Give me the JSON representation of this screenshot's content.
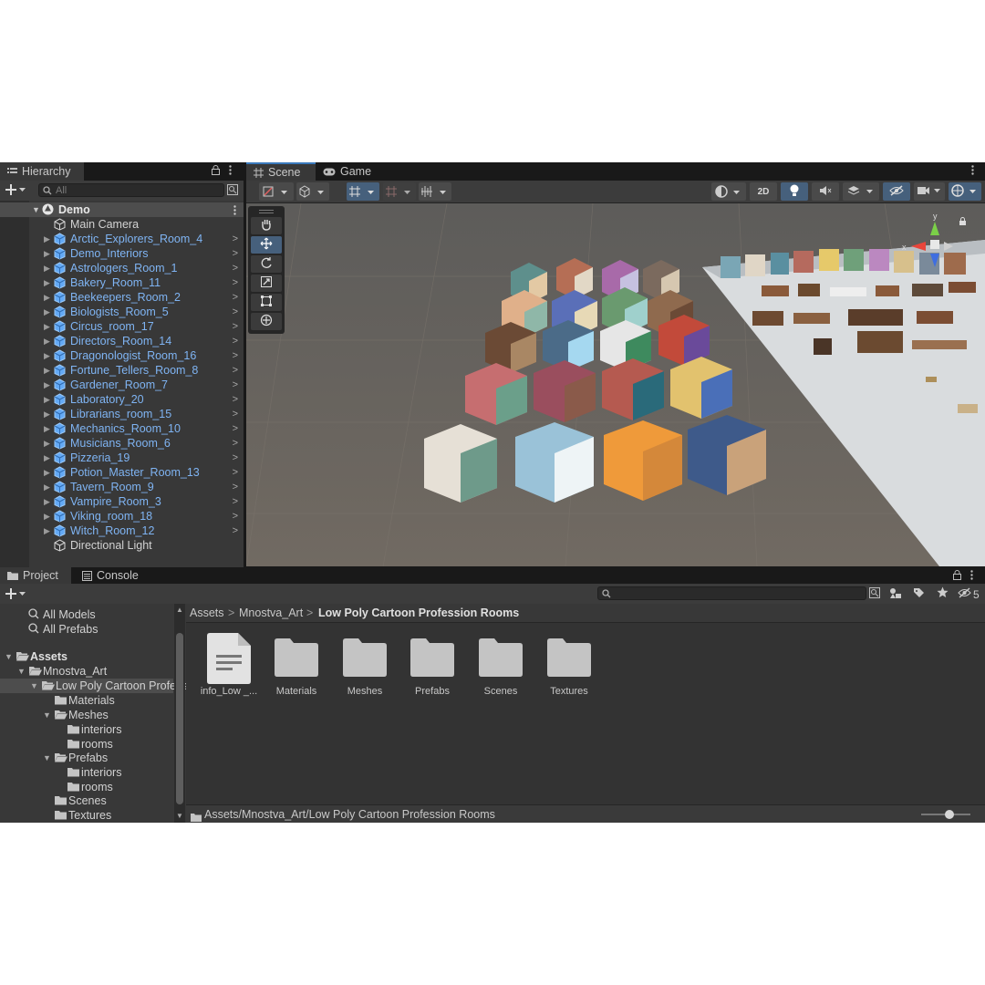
{
  "hierarchy": {
    "tab_label": "Hierarchy",
    "search_placeholder": "All",
    "scene_name": "Demo",
    "items": [
      {
        "label": "Main Camera",
        "prefab": false,
        "expandable": false
      },
      {
        "label": "Arctic_Explorers_Room_4",
        "prefab": true,
        "expandable": true
      },
      {
        "label": "Demo_Interiors",
        "prefab": true,
        "expandable": true
      },
      {
        "label": "Astrologers_Room_1",
        "prefab": true,
        "expandable": true
      },
      {
        "label": "Bakery_Room_11",
        "prefab": true,
        "expandable": true
      },
      {
        "label": "Beekeepers_Room_2",
        "prefab": true,
        "expandable": true
      },
      {
        "label": "Biologists_Room_5",
        "prefab": true,
        "expandable": true
      },
      {
        "label": "Circus_room_17",
        "prefab": true,
        "expandable": true
      },
      {
        "label": "Directors_Room_14",
        "prefab": true,
        "expandable": true
      },
      {
        "label": "Dragonologist_Room_16",
        "prefab": true,
        "expandable": true
      },
      {
        "label": "Fortune_Tellers_Room_8",
        "prefab": true,
        "expandable": true
      },
      {
        "label": "Gardener_Room_7",
        "prefab": true,
        "expandable": true
      },
      {
        "label": "Laboratory_20",
        "prefab": true,
        "expandable": true
      },
      {
        "label": "Librarians_room_15",
        "prefab": true,
        "expandable": true
      },
      {
        "label": "Mechanics_Room_10",
        "prefab": true,
        "expandable": true
      },
      {
        "label": "Musicians_Room_6",
        "prefab": true,
        "expandable": true
      },
      {
        "label": "Pizzeria_19",
        "prefab": true,
        "expandable": true
      },
      {
        "label": "Potion_Master_Room_13",
        "prefab": true,
        "expandable": true
      },
      {
        "label": "Tavern_Room_9",
        "prefab": true,
        "expandable": true
      },
      {
        "label": "Vampire_Room_3",
        "prefab": true,
        "expandable": true
      },
      {
        "label": "Viking_room_18",
        "prefab": true,
        "expandable": true
      },
      {
        "label": "Witch_Room_12",
        "prefab": true,
        "expandable": true
      },
      {
        "label": "Directional Light",
        "prefab": false,
        "expandable": false
      }
    ]
  },
  "scene": {
    "tabs": [
      {
        "label": "Scene",
        "icon": "grid-icon"
      },
      {
        "label": "Game",
        "icon": "gamepad-icon"
      }
    ],
    "mode_2d_label": "2D",
    "gizmo_axes": {
      "x": "x",
      "y": "y"
    },
    "tools": [
      "hand-tool",
      "move-tool",
      "rotate-tool",
      "scale-tool",
      "rect-tool",
      "transform-tool"
    ]
  },
  "project": {
    "tabs": [
      {
        "label": "Project",
        "icon": "folder-icon"
      },
      {
        "label": "Console",
        "icon": "console-icon"
      }
    ],
    "hidden_count": "5",
    "left_tree": [
      {
        "label": "All Models",
        "type": "search",
        "indent": 1
      },
      {
        "label": "All Prefabs",
        "type": "search",
        "indent": 1
      },
      {
        "label": "Assets",
        "type": "folder-open",
        "indent": 0,
        "bold": true
      },
      {
        "label": "Mnostva_Art",
        "type": "folder-open",
        "indent": 1
      },
      {
        "label": "Low Poly Cartoon Profession Rooms",
        "type": "folder-open",
        "indent": 2,
        "selected": true
      },
      {
        "label": "Materials",
        "type": "folder",
        "indent": 3
      },
      {
        "label": "Meshes",
        "type": "folder-open",
        "indent": 3
      },
      {
        "label": "interiors",
        "type": "folder",
        "indent": 4
      },
      {
        "label": "rooms",
        "type": "folder",
        "indent": 4
      },
      {
        "label": "Prefabs",
        "type": "folder-open",
        "indent": 3
      },
      {
        "label": "interiors",
        "type": "folder",
        "indent": 4
      },
      {
        "label": "rooms",
        "type": "folder",
        "indent": 4
      },
      {
        "label": "Scenes",
        "type": "folder",
        "indent": 3
      },
      {
        "label": "Textures",
        "type": "folder",
        "indent": 3
      }
    ],
    "breadcrumb": [
      "Assets",
      "Mnostva_Art",
      "Low Poly Cartoon Profession Rooms"
    ],
    "assets": [
      {
        "label": "info_Low _...",
        "type": "text-file-icon"
      },
      {
        "label": "Materials",
        "type": "folder-icon"
      },
      {
        "label": "Meshes",
        "type": "folder-icon"
      },
      {
        "label": "Prefabs",
        "type": "folder-icon"
      },
      {
        "label": "Scenes",
        "type": "folder-icon"
      },
      {
        "label": "Textures",
        "type": "folder-icon"
      }
    ],
    "status_path": "Assets/Mnostva_Art/Low Poly Cartoon Profession Rooms"
  },
  "colors": {
    "editor_bg": "#383838",
    "selection_blue": "#2c5d87",
    "prefab_text": "#7fb4f3",
    "folder_gray": "#c4c4c4",
    "scene_sky": "#6a6a69",
    "scene_ground": "#5e5c56"
  }
}
